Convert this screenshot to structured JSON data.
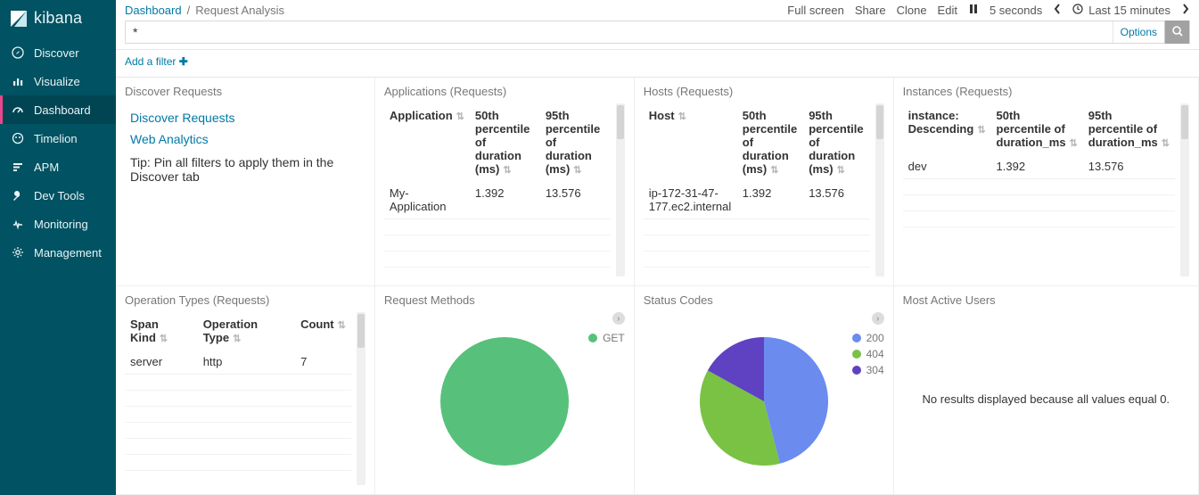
{
  "brand": {
    "name": "kibana"
  },
  "sidebar": {
    "items": [
      {
        "label": "Discover"
      },
      {
        "label": "Visualize"
      },
      {
        "label": "Dashboard"
      },
      {
        "label": "Timelion"
      },
      {
        "label": "APM"
      },
      {
        "label": "Dev Tools"
      },
      {
        "label": "Monitoring"
      },
      {
        "label": "Management"
      }
    ]
  },
  "breadcrumb": {
    "root": "Dashboard",
    "current": "Request Analysis"
  },
  "toolbar": {
    "full_screen": "Full screen",
    "share": "Share",
    "clone": "Clone",
    "edit": "Edit",
    "refresh_interval": "5 seconds",
    "time_range": "Last 15 minutes"
  },
  "search": {
    "query": "*",
    "options_label": "Options"
  },
  "filter_bar": {
    "add_label": "Add a filter"
  },
  "panels": {
    "discover": {
      "title": "Discover Requests",
      "link_discover": "Discover Requests",
      "link_web": "Web Analytics",
      "tip": "Tip: Pin all filters to apply them in the Discover tab"
    },
    "applications": {
      "title": "Applications (Requests)",
      "headers": {
        "app": "Application",
        "p50": "50th percentile of duration (ms)",
        "p95": "95th percentile of duration (ms)"
      },
      "rows": [
        {
          "app": "My-Application",
          "p50": "1.392",
          "p95": "13.576"
        }
      ]
    },
    "hosts": {
      "title": "Hosts (Requests)",
      "headers": {
        "host": "Host",
        "p50": "50th percentile of duration (ms)",
        "p95": "95th percentile of duration (ms)"
      },
      "rows": [
        {
          "host": "ip-172-31-47-177.ec2.internal",
          "p50": "1.392",
          "p95": "13.576"
        }
      ]
    },
    "instances": {
      "title": "Instances (Requests)",
      "headers": {
        "inst": "instance: Descending",
        "p50": "50th percentile of duration_ms",
        "p95": "95th percentile of duration_ms"
      },
      "rows": [
        {
          "inst": "dev",
          "p50": "1.392",
          "p95": "13.576"
        }
      ]
    },
    "optypes": {
      "title": "Operation Types (Requests)",
      "headers": {
        "kind": "Span Kind",
        "op": "Operation Type",
        "count": "Count"
      },
      "rows": [
        {
          "kind": "server",
          "op": "http",
          "count": "7"
        }
      ]
    },
    "methods": {
      "title": "Request Methods",
      "legend": [
        {
          "label": "GET",
          "color": "#57c17b"
        }
      ]
    },
    "status": {
      "title": "Status Codes",
      "legend": [
        {
          "label": "200",
          "color": "#6b8bef"
        },
        {
          "label": "404",
          "color": "#7ac244"
        },
        {
          "label": "304",
          "color": "#5f42c2"
        }
      ]
    },
    "users": {
      "title": "Most Active Users",
      "message": "No results displayed because all values equal 0."
    }
  },
  "chart_data": [
    {
      "type": "pie",
      "title": "Request Methods",
      "series": [
        {
          "name": "GET",
          "value": 100,
          "color": "#57c17b"
        }
      ]
    },
    {
      "type": "pie",
      "title": "Status Codes",
      "series": [
        {
          "name": "200",
          "value": 46,
          "color": "#6b8bef"
        },
        {
          "name": "404",
          "value": 37,
          "color": "#7ac244"
        },
        {
          "name": "304",
          "value": 17,
          "color": "#5f42c2"
        }
      ]
    }
  ]
}
